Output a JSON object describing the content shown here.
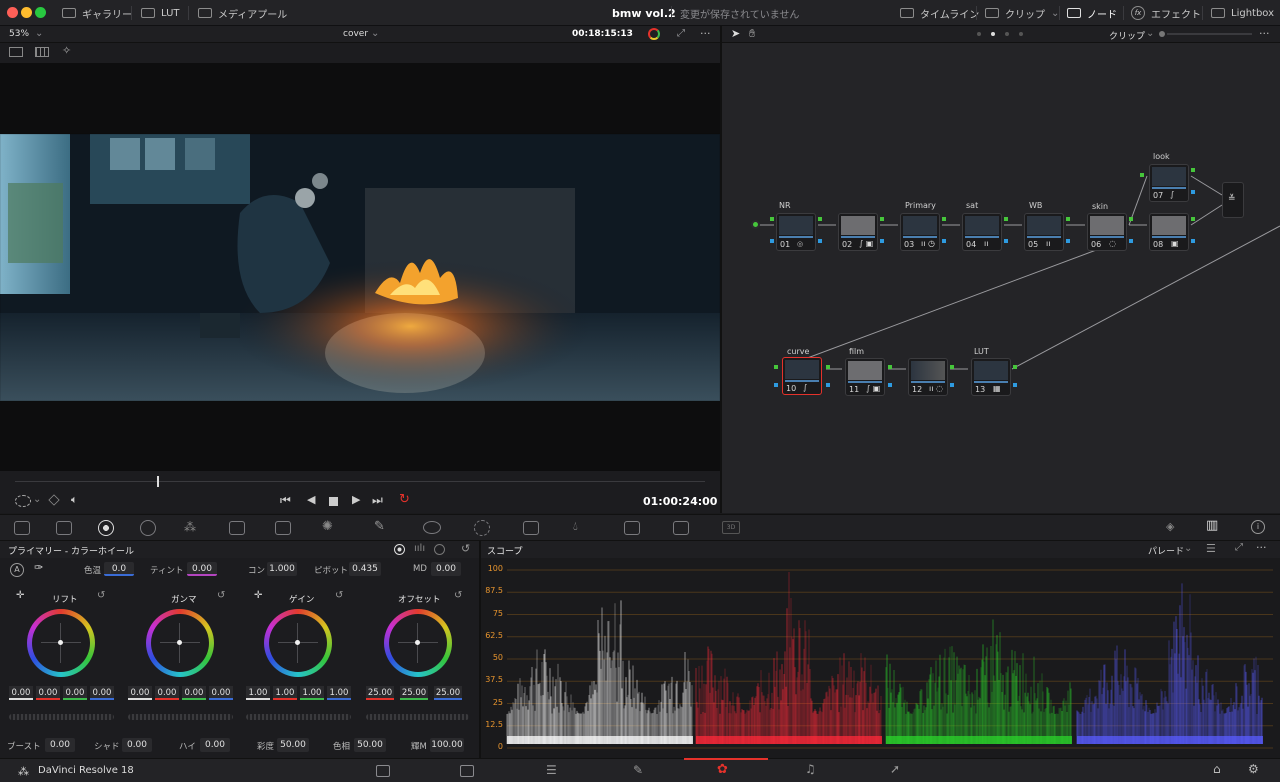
{
  "titlebar": {
    "tabs_left": [
      "ギャラリー",
      "LUT",
      "メディアプール"
    ],
    "project": "bmw vol.2",
    "save_status": "変更が保存されていません",
    "tabs_right": [
      "タイムライン",
      "クリップ",
      "ノード",
      "エフェクト",
      "Lightbox"
    ]
  },
  "viewer": {
    "zoom": "53%",
    "clip_name": "cover",
    "timecode": "00:18:15:13",
    "playhead_timecode": "01:00:24:00"
  },
  "node_editor": {
    "mode": "クリップ",
    "nodes": [
      {
        "num": "01",
        "name": "NR"
      },
      {
        "num": "02",
        "name": ""
      },
      {
        "num": "03",
        "name": "Primary"
      },
      {
        "num": "04",
        "name": "sat"
      },
      {
        "num": "05",
        "name": "WB"
      },
      {
        "num": "06",
        "name": "skin"
      },
      {
        "num": "07",
        "name": "look"
      },
      {
        "num": "08",
        "name": ""
      },
      {
        "num": "10",
        "name": "curve"
      },
      {
        "num": "11",
        "name": "film"
      },
      {
        "num": "12",
        "name": ""
      },
      {
        "num": "13",
        "name": "LUT"
      }
    ]
  },
  "primaries": {
    "title": "プライマリー - カラーホイール",
    "top_params": [
      {
        "label": "色温",
        "value": "0.0"
      },
      {
        "label": "ティント",
        "value": "0.00"
      },
      {
        "label": "コン",
        "value": "1.000"
      },
      {
        "label": "ピボット",
        "value": "0.435"
      },
      {
        "label": "MD",
        "value": "0.00"
      }
    ],
    "wheels": [
      {
        "label": "リフト",
        "values": [
          "0.00",
          "0.00",
          "0.00",
          "0.00"
        ]
      },
      {
        "label": "ガンマ",
        "values": [
          "0.00",
          "0.00",
          "0.00",
          "0.00"
        ]
      },
      {
        "label": "ゲイン",
        "values": [
          "1.00",
          "1.00",
          "1.00",
          "1.00"
        ]
      },
      {
        "label": "オフセット",
        "values": [
          "25.00",
          "25.00",
          "25.00"
        ]
      }
    ],
    "bottom_params": [
      {
        "label": "ブースト",
        "value": "0.00"
      },
      {
        "label": "シャド",
        "value": "0.00"
      },
      {
        "label": "ハイ",
        "value": "0.00"
      },
      {
        "label": "彩度",
        "value": "50.00"
      },
      {
        "label": "色相",
        "value": "50.00"
      },
      {
        "label": "輝M",
        "value": "100.00"
      }
    ]
  },
  "scope": {
    "title": "スコープ",
    "mode": "パレード",
    "ticks": [
      "100",
      "87.5",
      "75",
      "62.5",
      "50",
      "37.5",
      "25",
      "12.5",
      "0"
    ],
    "colors": {
      "r": "#ff2a3a",
      "g": "#2bd42b",
      "b": "#5a5cff",
      "luma": "#ffffff"
    }
  },
  "bottombar": {
    "app_name": "DaVinci Resolve 18"
  },
  "colors": {
    "accent_red": "#e5322b",
    "accent_orange": "#e8952e",
    "node_green": "#46c63b",
    "node_blue": "#2e9be0"
  }
}
